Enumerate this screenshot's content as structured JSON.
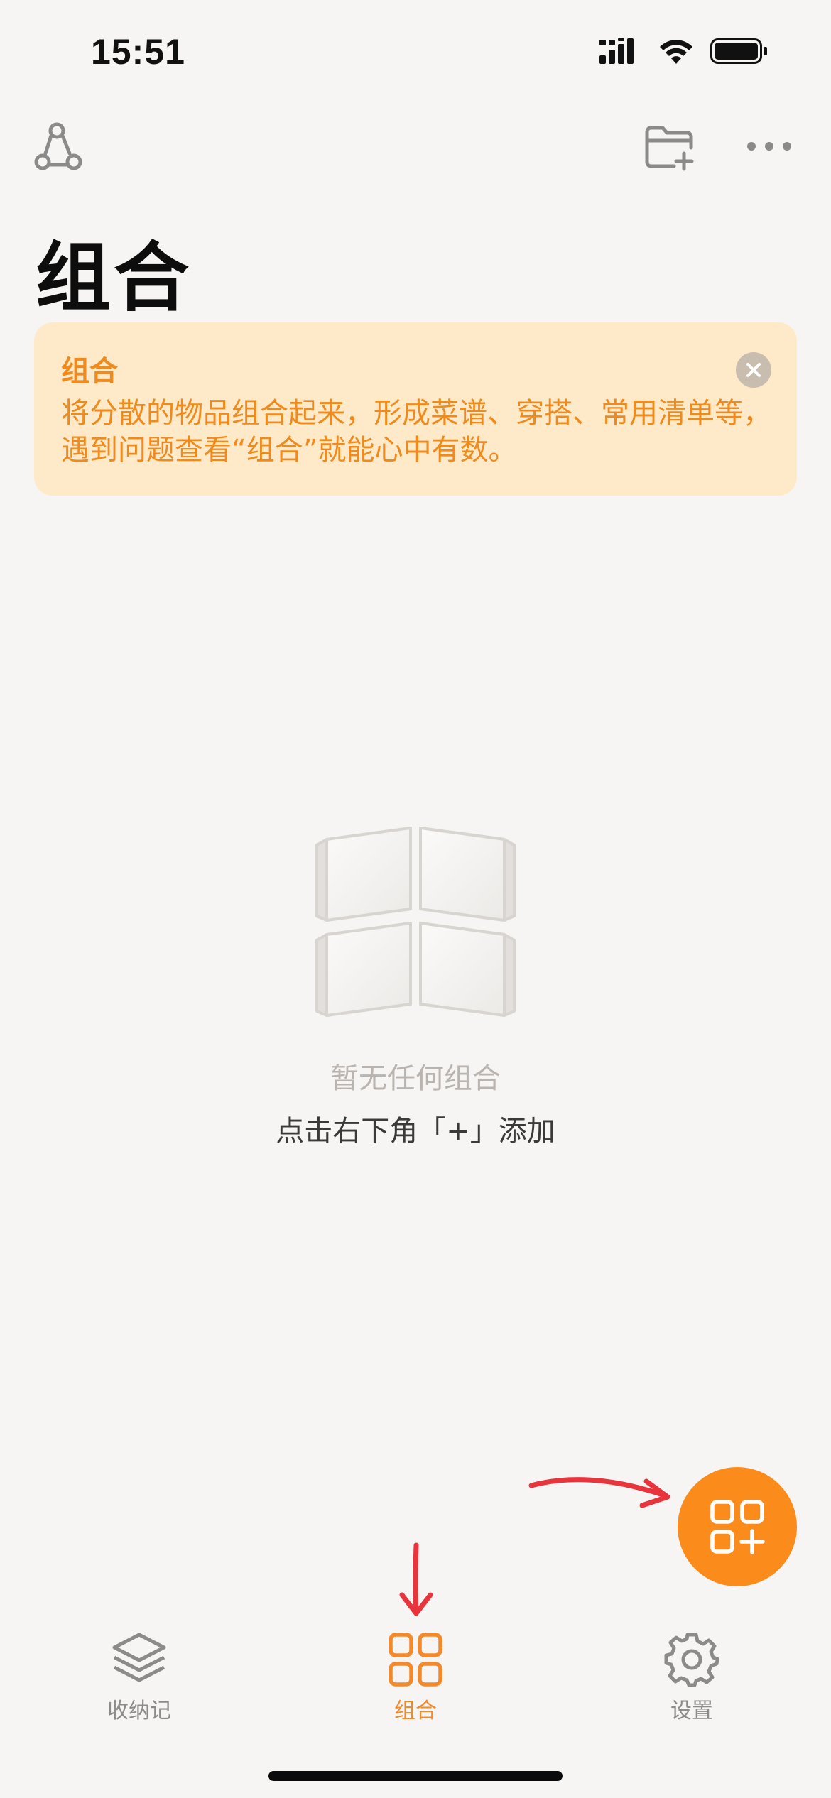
{
  "status_bar": {
    "time": "15:51"
  },
  "page": {
    "title": "组合"
  },
  "tip": {
    "title": "组合",
    "body": "将分散的物品组合起来，形成菜谱、穿搭、常用清单等，遇到问题查看“组合”就能心中有数。"
  },
  "empty_state": {
    "title": "暂无任何组合",
    "hint": "点击右下角「+」添加"
  },
  "tabs": [
    {
      "label": "收纳记",
      "icon": "stack-layers-icon",
      "active": false
    },
    {
      "label": "组合",
      "icon": "grid-four-icon",
      "active": true
    },
    {
      "label": "设置",
      "icon": "gear-icon",
      "active": false
    }
  ],
  "colors": {
    "accent": "#FB8C1C",
    "tip_background": "#FEE9C9",
    "background": "#F7F5F3",
    "annotation_red": "#E8343C"
  }
}
